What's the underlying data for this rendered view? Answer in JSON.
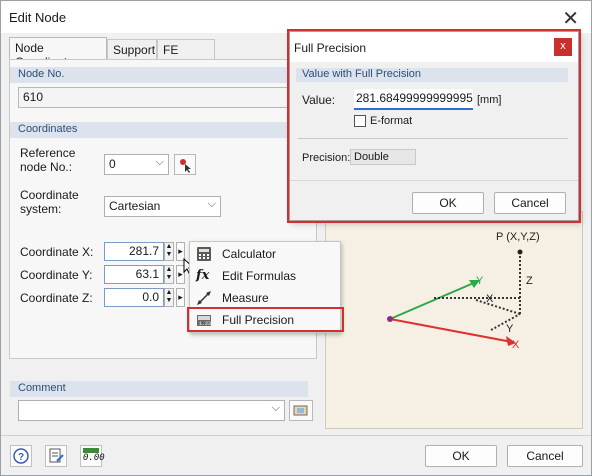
{
  "dialog": {
    "title": "Edit Node"
  },
  "tabs": [
    {
      "label": "Node Coordinates",
      "active": true
    },
    {
      "label": "Support"
    },
    {
      "label": "FE Mesh"
    }
  ],
  "node": {
    "header": "Node No.",
    "value": "610"
  },
  "coordinates": {
    "header": "Coordinates",
    "reference_label": "Reference\nnode No.:",
    "reference_value": "0",
    "system_label": "Coordinate\nsystem:",
    "system_value": "Cartesian",
    "x_label": "Coordinate X:",
    "x_value": "281.7",
    "y_label": "Coordinate Y:",
    "y_value": "63.1",
    "z_label": "Coordinate Z:",
    "z_value": "0.0"
  },
  "context_menu": {
    "items": [
      {
        "label": "Calculator",
        "icon": "calculator-icon"
      },
      {
        "label": "Edit Formulas",
        "icon": "formula-icon"
      },
      {
        "label": "Measure",
        "icon": "measure-icon"
      },
      {
        "label": "Full Precision",
        "icon": "full-precision-icon"
      }
    ]
  },
  "comment": {
    "header": "Comment",
    "value": ""
  },
  "full_precision": {
    "title": "Full Precision",
    "close": "x",
    "group_header": "Value with Full Precision",
    "value_label": "Value:",
    "value": "281.68499999999995",
    "unit": "[mm]",
    "eformat_label": "E-format",
    "precision_label": "Precision:",
    "precision_value": "Double",
    "ok": "OK",
    "cancel": "Cancel"
  },
  "preview": {
    "point_label": "P (X,Y,Z)",
    "axis_x": "X",
    "axis_y": "Y",
    "axis_z": "Z",
    "dim_x": "X",
    "dim_y": "Y",
    "dim_z": "Z",
    "colors": {
      "x_axis": "#e03030",
      "y_axis": "#2aa84a",
      "z_axis": "#333333",
      "origin": "#8a2c8a"
    }
  },
  "footer": {
    "ok": "OK",
    "cancel": "Cancel",
    "units_icon_text": "0.00"
  }
}
